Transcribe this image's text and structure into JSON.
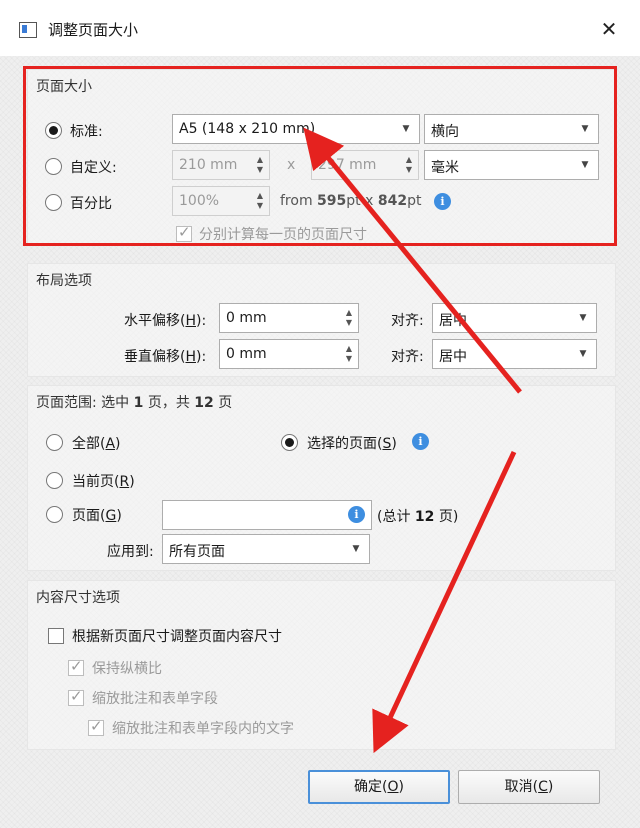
{
  "window": {
    "title": "调整页面大小"
  },
  "page_size": {
    "section_title": "页面大小",
    "standard_label": "标准:",
    "custom_label": "自定义:",
    "percent_label": "百分比",
    "standard_value": "A5 (148 x 210 mm)",
    "orientation_value": "横向",
    "custom_width": "210 mm",
    "times_sign": "x",
    "custom_height": "297 mm",
    "unit_value": "毫米",
    "percent_value": "100%",
    "from_prefix": "from ",
    "from_w": "595",
    "from_w_unit": "pt",
    "from_x": " x ",
    "from_h": "842",
    "from_h_unit": "pt",
    "per_page_label": "分别计算每一页的页面尺寸"
  },
  "layout": {
    "section_title": "布局选项",
    "h_offset_label": "水平偏移(",
    "h_offset_key": "H",
    "h_offset_suffix": "):",
    "h_offset_value": "0 mm",
    "v_offset_label": "垂直偏移(",
    "v_offset_key": "H",
    "v_offset_suffix": "):",
    "v_offset_value": "0 mm",
    "align_label_1": "对齐:",
    "align_value_1": "居中",
    "align_label_2": "对齐:",
    "align_value_2": "居中"
  },
  "page_range": {
    "title_prefix": "页面范围: 选中 ",
    "selected_count": "1",
    "title_middle": " 页，共 ",
    "total_count": "12",
    "title_suffix": " 页",
    "all_label": "全部(",
    "all_key": "A",
    "current_label": "当前页(",
    "current_key": "R",
    "pages_label": "页面(",
    "pages_key": "G",
    "close_paren": ")",
    "selected_pages_label": "选择的页面(",
    "selected_pages_key": "S",
    "pages_input_value": "",
    "total_prefix": "(总计 ",
    "total_value": "12",
    "total_suffix": " 页)",
    "apply_to_label": "应用到:",
    "apply_to_value": "所有页面"
  },
  "content_size": {
    "section_title": "内容尺寸选项",
    "resize_content_label": "根据新页面尺寸调整页面内容尺寸",
    "keep_ratio_label": "保持纵横比",
    "scale_annot_label": "缩放批注和表单字段",
    "scale_annot_text_label": "缩放批注和表单字段内的文字"
  },
  "buttons": {
    "ok_label": "确定(",
    "ok_key": "O",
    "cancel_label": "取消(",
    "cancel_key": "C",
    "close_paren": ")"
  },
  "colors": {
    "annotation_red": "#e5221f",
    "info_blue": "#3e8ee0",
    "default_button_border": "#4a90d9"
  }
}
